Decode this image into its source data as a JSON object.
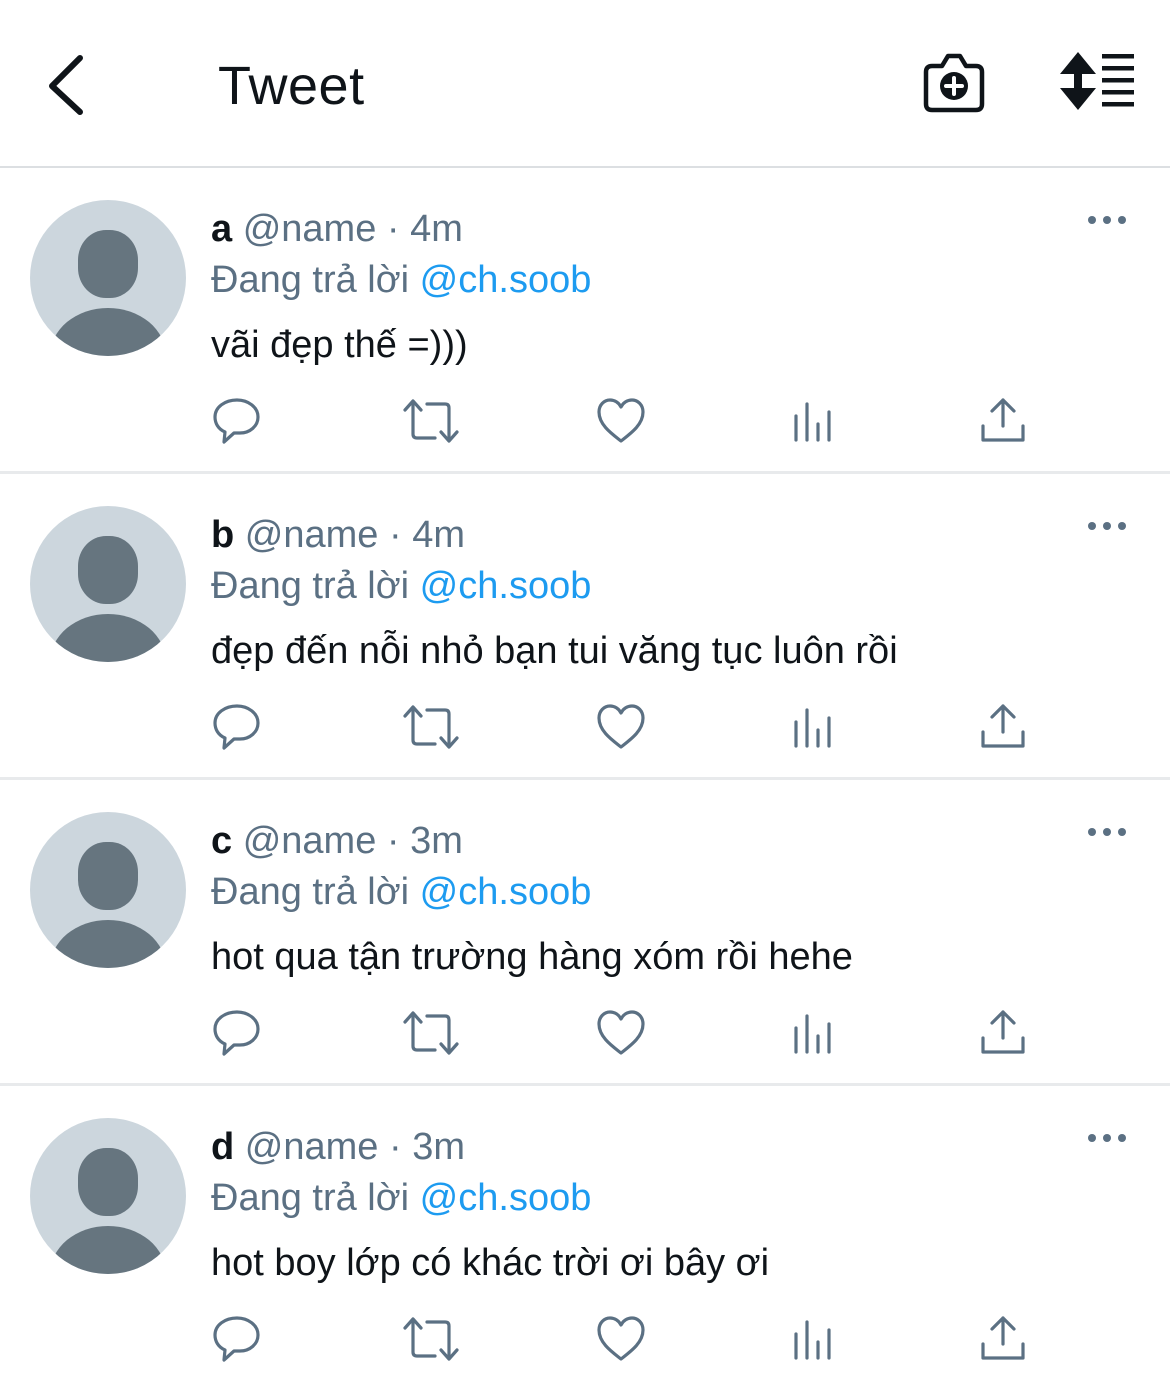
{
  "header": {
    "title": "Tweet",
    "back_icon": "chevron-left-icon",
    "camera_icon": "camera-plus-icon",
    "sort_icon": "sort-list-icon"
  },
  "colors": {
    "text": "#0f1419",
    "muted": "#5b7083",
    "accent": "#1d9bf0",
    "avatar_bg": "#ccd6dd",
    "avatar_fg": "#66757f"
  },
  "tweets": [
    {
      "author": "a",
      "handle": "@name",
      "sep": "·",
      "time": "4m",
      "reply_prefix": "Đang trả lời",
      "mention": "@ch.soob",
      "text": "vãi đẹp thế =)))"
    },
    {
      "author": "b",
      "handle": "@name",
      "sep": "·",
      "time": "4m",
      "reply_prefix": "Đang trả lời",
      "mention": "@ch.soob",
      "text": "đẹp đến nỗi nhỏ bạn tui văng tục luôn rồi"
    },
    {
      "author": "c",
      "handle": "@name",
      "sep": "·",
      "time": "3m",
      "reply_prefix": "Đang trả lời",
      "mention": "@ch.soob",
      "text": "hot qua tận trường hàng xóm rồi hehe"
    },
    {
      "author": "d",
      "handle": "@name",
      "sep": "·",
      "time": "3m",
      "reply_prefix": "Đang trả lời",
      "mention": "@ch.soob",
      "text": "hot boy lớp có khác trời ơi bây ơi"
    }
  ],
  "action_icons": [
    "reply-icon",
    "retweet-icon",
    "like-icon",
    "analytics-icon",
    "share-icon"
  ]
}
